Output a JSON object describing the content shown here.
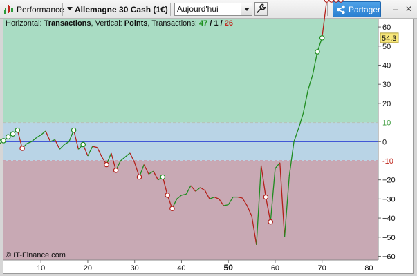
{
  "toolbar": {
    "performance_label": "Performance",
    "instrument_label": "Allemagne 30 Cash (1€)",
    "period_value": "Aujourd'hui",
    "share_label": "Partager",
    "minimize_label": "–",
    "close_label": "✕"
  },
  "chart_header": {
    "horizontal_prefix": "Horizontal: ",
    "horizontal_value": "Transactions",
    "vertical_prefix": ", Vertical: ",
    "vertical_value": "Points",
    "count_prefix": ", Transactions: ",
    "wins": "47",
    "slash1": " / ",
    "neutral": "1",
    "slash2": " / ",
    "losses": "26"
  },
  "credit": "© IT-Finance.com",
  "colors": {
    "profit_zone": "#a9dcc3",
    "neutral_zone": "#b9d4e6",
    "loss_zone": "#c8a9b4",
    "line_up": "#1f8c1f",
    "line_down": "#b3201a",
    "zero_line": "#1a2fd0",
    "band_line": "#b8c0b8",
    "band_line_low": "#d9707a",
    "last_value_bg": "#f7e67a"
  },
  "chart_data": {
    "type": "line",
    "xlabel": "",
    "ylabel": "",
    "xlim": [
      2,
      82
    ],
    "ylim": [
      -62,
      64
    ],
    "x_ticks": [
      10,
      20,
      30,
      40,
      50,
      60,
      70,
      80
    ],
    "x_bold_tick": 50,
    "y_ticks": [
      60,
      50,
      40,
      30,
      20,
      0,
      -20,
      -30,
      -40,
      -50,
      -60
    ],
    "band_upper": 10,
    "band_lower": -10,
    "band_upper_label": "10",
    "band_lower_label": "-10",
    "last_value": 54.3,
    "last_value_label": "54,3",
    "x": [
      1,
      2,
      3,
      4,
      5,
      6,
      7,
      8,
      9,
      10,
      11,
      12,
      13,
      14,
      15,
      16,
      17,
      18,
      19,
      20,
      21,
      22,
      23,
      24,
      25,
      26,
      27,
      28,
      29,
      30,
      31,
      32,
      33,
      34,
      35,
      36,
      37,
      38,
      39,
      40,
      41,
      42,
      43,
      44,
      45,
      46,
      47,
      48,
      49,
      50,
      51,
      52,
      53,
      54,
      55,
      56,
      57,
      58,
      59,
      60,
      61,
      62,
      63,
      64,
      65,
      66,
      67,
      68,
      69,
      70,
      71,
      72,
      73,
      74
    ],
    "y": [
      0,
      0.5,
      2.5,
      4,
      6,
      -3.5,
      -1,
      0,
      2,
      3.5,
      5.5,
      0,
      1,
      -4,
      -1.5,
      0,
      6,
      -4,
      -1.5,
      -7.5,
      -2.5,
      -3,
      -8,
      -12,
      -6,
      -15,
      -10,
      -8,
      -6,
      -11,
      -18.5,
      -12,
      -17,
      -15.5,
      -20,
      -18.5,
      -28,
      -35,
      -30,
      -28,
      -27.5,
      -23,
      -26,
      -24,
      -25.5,
      -30,
      -29,
      -30,
      -33.5,
      -33,
      -29,
      -29,
      -29.5,
      -33.5,
      -39,
      -54,
      -12.5,
      -29,
      -42,
      -14,
      -11,
      -50,
      -18,
      0,
      7,
      15,
      27,
      35,
      47,
      54.3
    ],
    "markers": [
      1,
      2,
      3,
      4,
      5,
      6,
      17,
      19,
      24,
      26,
      31,
      36,
      37,
      38,
      58,
      59,
      69,
      70,
      71,
      72,
      73,
      74
    ]
  }
}
